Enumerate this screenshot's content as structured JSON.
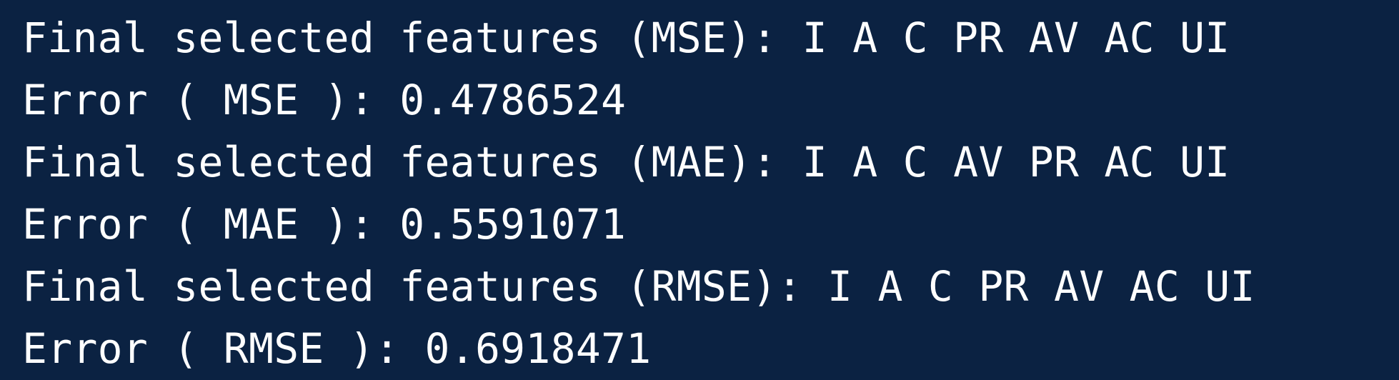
{
  "terminal": {
    "background": "#0b2242",
    "text_color": "#ffffff",
    "lines": [
      "Final selected features (MSE): I A C PR AV AC UI",
      "Error ( MSE ): 0.4786524",
      "Final selected features (MAE): I A C AV PR AC UI",
      "Error ( MAE ): 0.5591071",
      "Final selected features (RMSE): I A C PR AV AC UI",
      "Error ( RMSE ): 0.6918471"
    ]
  }
}
